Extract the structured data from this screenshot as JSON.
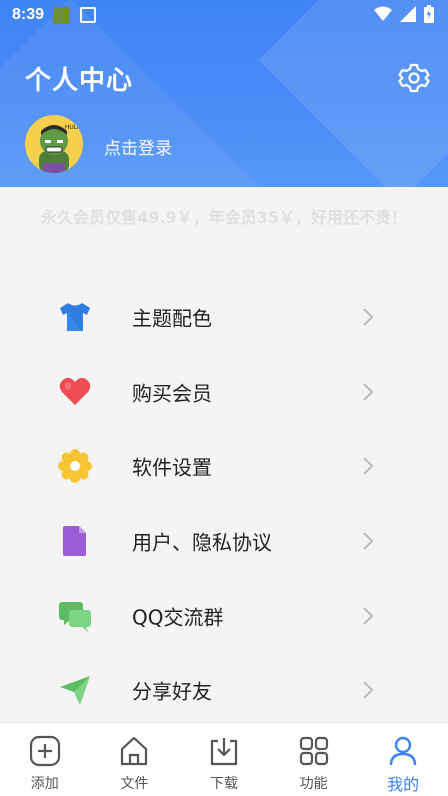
{
  "status": {
    "time": "8:39"
  },
  "header": {
    "title": "个人中心",
    "login_text": "点击登录"
  },
  "promo_text": "永久会员仅售49.9￥，年会员35￥，好用还不贵！",
  "menu": [
    {
      "label": "主题配色",
      "icon": "tshirt-icon"
    },
    {
      "label": "购买会员",
      "icon": "heart-icon"
    },
    {
      "label": "软件设置",
      "icon": "gear-flower-icon"
    },
    {
      "label": "用户、隐私协议",
      "icon": "document-icon"
    },
    {
      "label": "QQ交流群",
      "icon": "chat-icon"
    },
    {
      "label": "分享好友",
      "icon": "send-icon"
    }
  ],
  "nav": [
    {
      "label": "添加",
      "icon": "add-icon"
    },
    {
      "label": "文件",
      "icon": "home-icon"
    },
    {
      "label": "下载",
      "icon": "download-icon"
    },
    {
      "label": "功能",
      "icon": "grid-icon"
    },
    {
      "label": "我的",
      "icon": "user-icon",
      "active": true
    }
  ],
  "colors": {
    "primary": "#3b82f6",
    "header": "#4a8bf6"
  }
}
